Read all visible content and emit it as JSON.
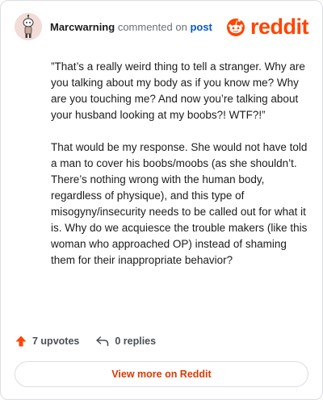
{
  "header": {
    "username": "Marcwarning",
    "action_text": "commented on",
    "post_link": "post",
    "avatar_icon": "snoo-avatar-icon"
  },
  "brand": {
    "icon": "reddit-snoo-icon",
    "wordmark": "reddit",
    "color": "#ff4500"
  },
  "comment": {
    "paragraphs": [
      "”That’s a really weird thing to tell a stranger. Why are you talking about my body as if you know me? Why are you touching me? And now you’re talking about your husband looking at my boobs?! WTF?!”",
      "That would be my response. She would not have told a man to cover his boobs/moobs (as she shouldn’t. There’s nothing wrong with the human body, regardless of physique), and this type of misogyny/insecurity needs to be called out for what it is. Why do we acquiesce the trouble makers (like this woman who approached OP) instead of shaming them for their inappropriate behavior?"
    ]
  },
  "actions": {
    "upvotes_label": "7 upvotes",
    "upvote_icon": "upvote-arrow-icon",
    "replies_label": "0 replies",
    "reply_icon": "reply-arrow-icon"
  },
  "footer": {
    "view_more_label": "View more on Reddit",
    "accent": "#d93a00"
  }
}
